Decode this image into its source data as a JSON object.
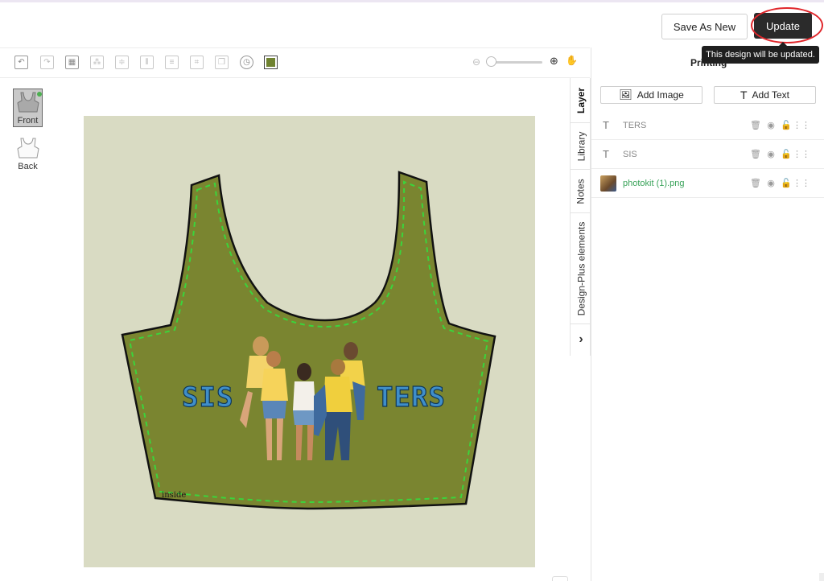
{
  "header": {
    "save_as_new_label": "Save As New",
    "update_label": "Update",
    "tooltip": "This design will be updated."
  },
  "toolbar": {
    "tools": [
      {
        "name": "undo-icon",
        "glyph": "↶"
      },
      {
        "name": "redo-icon",
        "glyph": "↷"
      },
      {
        "name": "grid-icon",
        "glyph": "▦"
      },
      {
        "name": "arrange-icon",
        "glyph": "⁂"
      },
      {
        "name": "align-vertical-icon",
        "glyph": "≑"
      },
      {
        "name": "align-columns-icon",
        "glyph": "⫴"
      },
      {
        "name": "align-rows-icon",
        "glyph": "≡"
      },
      {
        "name": "crop-icon",
        "glyph": "⌗"
      },
      {
        "name": "duplicate-icon",
        "glyph": "❐"
      },
      {
        "name": "history-icon",
        "glyph": "◷"
      }
    ],
    "color_swatch": "#6f8230"
  },
  "views": [
    {
      "label": "Front",
      "active": true
    },
    {
      "label": "Back",
      "active": false
    }
  ],
  "canvas": {
    "background": "#d9dbc3",
    "garment_color": "#7a8530",
    "text_left": "SIS",
    "text_right": "TERS",
    "inside_label": "inside"
  },
  "vertical_tabs": [
    {
      "label": "Layer",
      "active": true
    },
    {
      "label": "Library",
      "active": false
    },
    {
      "label": "Notes",
      "active": false
    },
    {
      "label": "Design-Plus elements",
      "active": false
    },
    {
      "label": "›",
      "active": false
    }
  ],
  "panel": {
    "title": "Printing",
    "add_image_label": "Add Image",
    "add_text_label": "Add Text",
    "layers": [
      {
        "type": "text",
        "name": "TERS"
      },
      {
        "type": "text",
        "name": "SIS"
      },
      {
        "type": "image",
        "name": "photokit (1).png"
      }
    ]
  }
}
